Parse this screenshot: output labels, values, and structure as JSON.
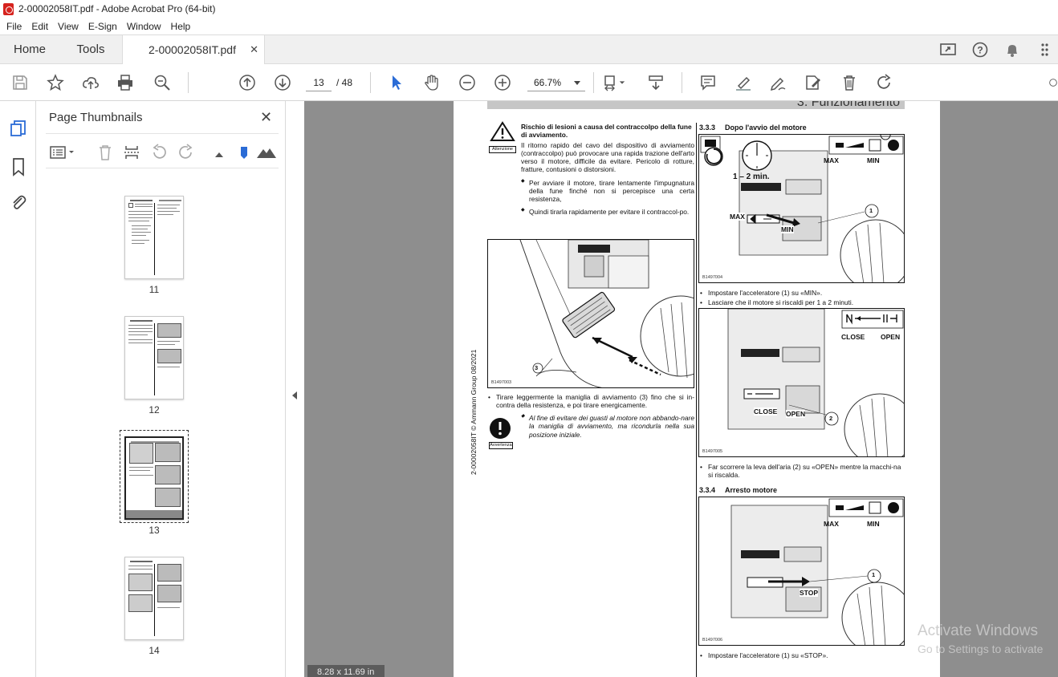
{
  "window": {
    "title": "2-00002058IT.pdf - Adobe Acrobat Pro (64-bit)"
  },
  "menu": [
    "File",
    "Edit",
    "View",
    "E-Sign",
    "Window",
    "Help"
  ],
  "tabs": {
    "home": "Home",
    "tools": "Tools",
    "document": "2-00002058IT.pdf"
  },
  "toolbar": {
    "current_page": "13",
    "total_pages": "/ 48",
    "zoom": "66.7%"
  },
  "panel": {
    "title": "Page Thumbnails",
    "thumbnails": [
      {
        "label": "11"
      },
      {
        "label": "12"
      },
      {
        "label": "13",
        "selected": true
      },
      {
        "label": "14"
      }
    ]
  },
  "page_size": "8.28 x 11.69 in",
  "document": {
    "header": "3. Funzionamento",
    "side_text": "2-00002058IT © Ammann Group 08/2021",
    "warning_label": "Attenzione",
    "warning_title": "Rischio di lesioni a causa del contraccolpo della fune di avviamento.",
    "warning_body": "Il ritorno rapido del cavo del dispositivo di avviamento (contraccolpo) può provocare una rapida trazione dell'arto verso il motore, difficile da evitare. Pericolo di rotture, fratture, contusioni o distorsioni.",
    "warning_bullets": [
      "Per avviare il motore, tirare lentamente l'impugnatura della fune finché non si percepisce una certa resistenza,",
      "Quindi tirarla rapidamente per evitare il contraccol-po."
    ],
    "fig1_id": "B1497003",
    "fig1_callout": "3",
    "step_pull": "Tirare leggermente la maniglia di avviamento (3) fino che si in-contra della resistenza, e poi tirare energicamente.",
    "notice_label": "Avvertenza",
    "notice_text": "Al fine di evitare dei guasti al motore non abbando-nare la maniglia di avviamento, ma ricondurla nella sua posizione iniziale.",
    "section_333": {
      "num": "3.3.3",
      "title": "Dopo l'avvio del motore"
    },
    "fig2": {
      "id": "B1497004",
      "time": "1 – 2 min.",
      "max": "MAX",
      "min": "MIN",
      "max2": "MAX",
      "min2": "MIN",
      "callout": "1"
    },
    "step_min": "Impostare l'acceleratore (1) su «MIN».",
    "step_warm": "Lasciare che il motore si riscaldi per 1 a 2 minuti.",
    "fig3": {
      "id": "B1497005",
      "close": "CLOSE",
      "open": "OPEN",
      "close2": "CLOSE",
      "open2": "OPEN",
      "callout": "2"
    },
    "step_open": "Far scorrere la leva dell'aria (2) su «OPEN» mentre la macchi-na si riscalda.",
    "section_334": {
      "num": "3.3.4",
      "title": "Arresto motore"
    },
    "fig4": {
      "id": "B1497006",
      "max": "MAX",
      "min": "MIN",
      "stop": "STOP",
      "callout": "1"
    },
    "step_stop": "Impostare l'acceleratore (1) su «STOP»."
  },
  "watermark": {
    "line1": "Activate Windows",
    "line2": "Go to Settings to activate"
  }
}
